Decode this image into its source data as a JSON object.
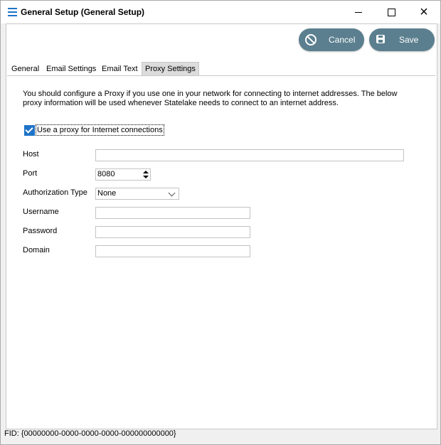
{
  "window": {
    "title": "General Setup (General Setup)",
    "icon": "hamburger-list-icon",
    "controls": {
      "minimize": "minimize-icon",
      "maximize": "maximize-icon",
      "close": "×"
    }
  },
  "toolbar": {
    "cancel_label": "Cancel",
    "save_label": "Save",
    "button_color": "#5b7f8f"
  },
  "tabs": [
    {
      "label": "General"
    },
    {
      "label": "Email Settings"
    },
    {
      "label": "Email Text"
    },
    {
      "label": "Proxy Settings",
      "active": true
    }
  ],
  "proxy": {
    "intro": "You should configure a Proxy if you use one in your network for connecting to internet addresses.  The below proxy information will be used whenever Statelake needs to connect to an internet address.",
    "use_proxy_label": "Use a proxy for Internet connections",
    "use_proxy_checked": true,
    "host_label": "Host",
    "host_value": "",
    "port_label": "Port",
    "port_value": "8080",
    "auth_label": "Authorization Type",
    "auth_value": "None",
    "username_label": "Username",
    "username_value": "",
    "password_label": "Password",
    "password_value": "",
    "domain_label": "Domain",
    "domain_value": ""
  },
  "footer": {
    "fid": "FID: {00000000-0000-0000-0000-000000000000}"
  },
  "colors": {
    "accent": "#1e73c8",
    "panel_bg": "#ffffff",
    "window_bg": "#f0f0f0"
  }
}
